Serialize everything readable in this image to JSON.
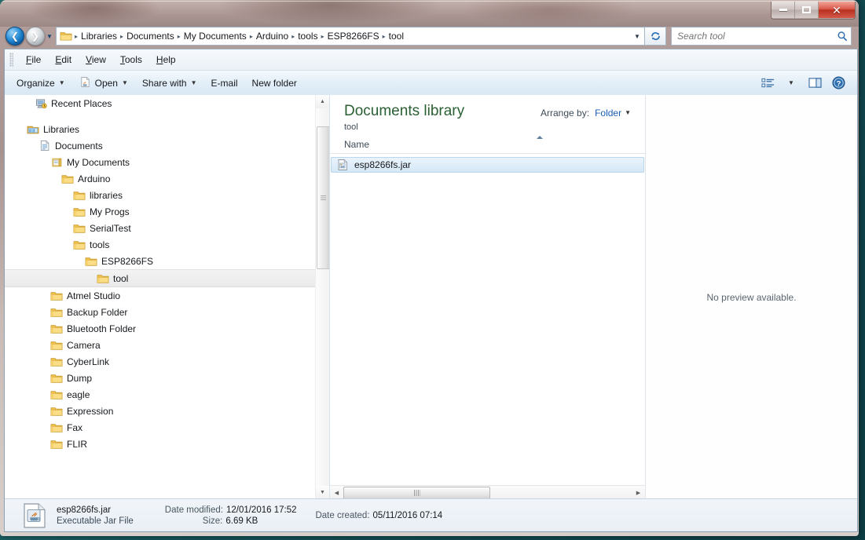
{
  "window": {
    "controls": {
      "minimize": "Minimize",
      "maximize": "Maximize",
      "close": "Close"
    }
  },
  "address": {
    "back_tooltip": "Back",
    "forward_tooltip": "Forward",
    "history_tooltip": "Recent pages",
    "crumbs": [
      "Libraries",
      "Documents",
      "My Documents",
      "Arduino",
      "tools",
      "ESP8266FS",
      "tool"
    ],
    "separator": "▸",
    "dropdown": "▼",
    "refresh_tooltip": "Refresh"
  },
  "search": {
    "placeholder": "Search tool",
    "value": "",
    "icon": "search-icon"
  },
  "menubar": {
    "items": [
      {
        "label": "File",
        "accel": "F",
        "rest": "ile"
      },
      {
        "label": "Edit",
        "accel": "E",
        "rest": "dit"
      },
      {
        "label": "View",
        "accel": "V",
        "rest": "iew"
      },
      {
        "label": "Tools",
        "accel": "T",
        "rest": "ools"
      },
      {
        "label": "Help",
        "accel": "H",
        "rest": "elp"
      }
    ]
  },
  "toolbar": {
    "organize": "Organize",
    "open": "Open",
    "share_with": "Share with",
    "email": "E-mail",
    "new_folder": "New folder",
    "caret": "▼",
    "views_tooltip": "Change your view",
    "preview_tooltip": "Show the preview pane",
    "help_tooltip": "Get help"
  },
  "navpane": {
    "items": [
      {
        "label": "Recent Places",
        "indent": 0,
        "icon": "recent-places-icon",
        "selected": false
      },
      {
        "label": "",
        "indent": 0,
        "icon": "spacer",
        "selected": false
      },
      {
        "label": "Libraries",
        "indent": 0,
        "icon": "libraries-icon",
        "selected": false
      },
      {
        "label": "Documents",
        "indent": 1,
        "icon": "documents-library-icon",
        "selected": false
      },
      {
        "label": "My Documents",
        "indent": 2,
        "icon": "my-documents-icon",
        "selected": false
      },
      {
        "label": "Arduino",
        "indent": 3,
        "icon": "folder-icon",
        "selected": false
      },
      {
        "label": "libraries",
        "indent": 4,
        "icon": "folder-icon",
        "selected": false
      },
      {
        "label": "My Progs",
        "indent": 4,
        "icon": "folder-icon",
        "selected": false
      },
      {
        "label": "SerialTest",
        "indent": 4,
        "icon": "folder-icon",
        "selected": false
      },
      {
        "label": "tools",
        "indent": 4,
        "icon": "folder-icon",
        "selected": false
      },
      {
        "label": "ESP8266FS",
        "indent": 5,
        "icon": "folder-icon",
        "selected": false
      },
      {
        "label": "tool",
        "indent": 6,
        "icon": "folder-icon",
        "selected": true
      },
      {
        "label": "Atmel Studio",
        "indent": 3,
        "icon": "folder-icon",
        "selected": false
      },
      {
        "label": "Backup Folder",
        "indent": 3,
        "icon": "folder-icon",
        "selected": false
      },
      {
        "label": "Bluetooth Folder",
        "indent": 3,
        "icon": "folder-icon",
        "selected": false
      },
      {
        "label": "Camera",
        "indent": 3,
        "icon": "folder-icon",
        "selected": false
      },
      {
        "label": "CyberLink",
        "indent": 3,
        "icon": "folder-icon",
        "selected": false
      },
      {
        "label": "Dump",
        "indent": 3,
        "icon": "folder-icon",
        "selected": false
      },
      {
        "label": "eagle",
        "indent": 3,
        "icon": "folder-icon",
        "selected": false
      },
      {
        "label": "Expression",
        "indent": 3,
        "icon": "folder-icon",
        "selected": false
      },
      {
        "label": "Fax",
        "indent": 3,
        "icon": "folder-icon",
        "selected": false
      },
      {
        "label": "FLIR",
        "indent": 3,
        "icon": "folder-icon",
        "selected": false
      }
    ],
    "scroll_up": "▲",
    "scroll_down": "▼"
  },
  "library": {
    "title": "Documents library",
    "subtitle": "tool",
    "arrange_label": "Arrange by:",
    "arrange_value": "Folder",
    "arrange_caret": "▼"
  },
  "filelist": {
    "columns": [
      "Name"
    ],
    "sort_column": "Name",
    "sort_direction": "ascending",
    "rows": [
      {
        "name": "esp8266fs.jar",
        "icon": "jar-file-icon",
        "selected": true
      }
    ],
    "hscroll_left": "◂",
    "hscroll_right": "▸"
  },
  "preview": {
    "text": "No preview available."
  },
  "details": {
    "file_name": "esp8266fs.jar",
    "file_type": "Executable Jar File",
    "date_modified_label": "Date modified:",
    "date_modified_value": "12/01/2016 17:52",
    "date_created_label": "Date created:",
    "date_created_value": "05/11/2016 07:14",
    "size_label": "Size:",
    "size_value": "6.69 KB",
    "icon": "jar-file-icon"
  },
  "colors": {
    "library_title": "#2a6033",
    "link": "#1a5fb4",
    "selection": "#d5e8f7",
    "close_button": "#b8301f"
  }
}
